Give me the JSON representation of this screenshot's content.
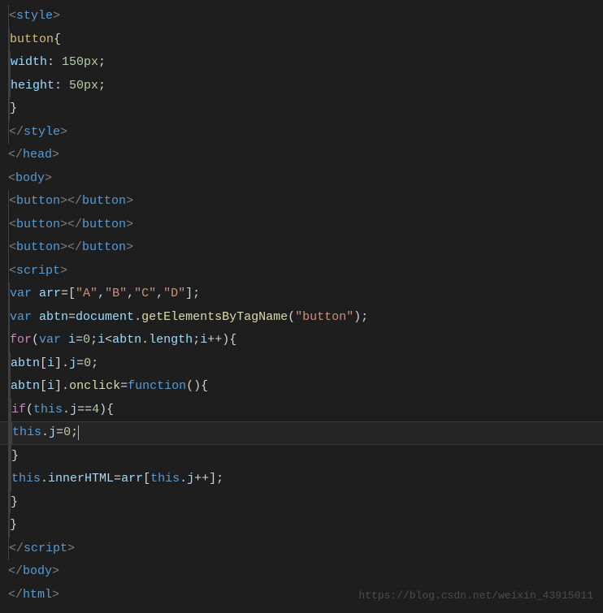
{
  "code": {
    "lines": [
      {
        "indent": 1,
        "tokens": [
          {
            "t": "<",
            "c": "tag-bracket"
          },
          {
            "t": "style",
            "c": "tag-name"
          },
          {
            "t": ">",
            "c": "tag-bracket"
          }
        ]
      },
      {
        "indent": 2,
        "tokens": [
          {
            "t": "button",
            "c": "selector"
          },
          {
            "t": "{",
            "c": "brace"
          }
        ]
      },
      {
        "indent": 3,
        "tokens": [
          {
            "t": "width",
            "c": "property"
          },
          {
            "t": ": ",
            "c": "punct"
          },
          {
            "t": "150px",
            "c": "value-num"
          },
          {
            "t": ";",
            "c": "punct"
          }
        ]
      },
      {
        "indent": 3,
        "tokens": [
          {
            "t": "height",
            "c": "property"
          },
          {
            "t": ": ",
            "c": "punct"
          },
          {
            "t": "50px",
            "c": "value-num"
          },
          {
            "t": ";",
            "c": "punct"
          }
        ]
      },
      {
        "indent": 2,
        "tokens": [
          {
            "t": "}",
            "c": "brace"
          }
        ]
      },
      {
        "indent": 1,
        "tokens": [
          {
            "t": "</",
            "c": "tag-bracket"
          },
          {
            "t": "style",
            "c": "tag-name"
          },
          {
            "t": ">",
            "c": "tag-bracket"
          }
        ]
      },
      {
        "indent": 0,
        "tokens": [
          {
            "t": "</",
            "c": "tag-bracket"
          },
          {
            "t": "head",
            "c": "tag-name"
          },
          {
            "t": ">",
            "c": "tag-bracket"
          }
        ]
      },
      {
        "indent": 0,
        "tokens": [
          {
            "t": "<",
            "c": "tag-bracket"
          },
          {
            "t": "body",
            "c": "tag-name"
          },
          {
            "t": ">",
            "c": "tag-bracket"
          }
        ]
      },
      {
        "indent": 1,
        "tokens": [
          {
            "t": "<",
            "c": "tag-bracket"
          },
          {
            "t": "button",
            "c": "tag-name"
          },
          {
            "t": "></",
            "c": "tag-bracket"
          },
          {
            "t": "button",
            "c": "tag-name"
          },
          {
            "t": ">",
            "c": "tag-bracket"
          }
        ]
      },
      {
        "indent": 1,
        "tokens": [
          {
            "t": "<",
            "c": "tag-bracket"
          },
          {
            "t": "button",
            "c": "tag-name"
          },
          {
            "t": "></",
            "c": "tag-bracket"
          },
          {
            "t": "button",
            "c": "tag-name"
          },
          {
            "t": ">",
            "c": "tag-bracket"
          }
        ]
      },
      {
        "indent": 1,
        "tokens": [
          {
            "t": "<",
            "c": "tag-bracket"
          },
          {
            "t": "button",
            "c": "tag-name"
          },
          {
            "t": "></",
            "c": "tag-bracket"
          },
          {
            "t": "button",
            "c": "tag-name"
          },
          {
            "t": ">",
            "c": "tag-bracket"
          }
        ]
      },
      {
        "indent": 1,
        "tokens": [
          {
            "t": "<",
            "c": "tag-bracket"
          },
          {
            "t": "script",
            "c": "tag-name"
          },
          {
            "t": ">",
            "c": "tag-bracket"
          }
        ]
      },
      {
        "indent": 2,
        "tokens": [
          {
            "t": "var ",
            "c": "keyword"
          },
          {
            "t": "arr",
            "c": "variable"
          },
          {
            "t": "=[",
            "c": "punct"
          },
          {
            "t": "\"A\"",
            "c": "string"
          },
          {
            "t": ",",
            "c": "punct"
          },
          {
            "t": "\"B\"",
            "c": "string"
          },
          {
            "t": ",",
            "c": "punct"
          },
          {
            "t": "\"C\"",
            "c": "string"
          },
          {
            "t": ",",
            "c": "punct"
          },
          {
            "t": "\"D\"",
            "c": "string"
          },
          {
            "t": "];",
            "c": "punct"
          }
        ]
      },
      {
        "indent": 2,
        "tokens": [
          {
            "t": "var ",
            "c": "keyword"
          },
          {
            "t": "abtn",
            "c": "variable"
          },
          {
            "t": "=",
            "c": "punct"
          },
          {
            "t": "document",
            "c": "obj"
          },
          {
            "t": ".",
            "c": "punct"
          },
          {
            "t": "getElementsByTagName",
            "c": "method"
          },
          {
            "t": "(",
            "c": "punct"
          },
          {
            "t": "\"button\"",
            "c": "string"
          },
          {
            "t": ");",
            "c": "punct"
          }
        ]
      },
      {
        "indent": 2,
        "tokens": [
          {
            "t": "for",
            "c": "keyword-control"
          },
          {
            "t": "(",
            "c": "punct"
          },
          {
            "t": "var ",
            "c": "keyword"
          },
          {
            "t": "i",
            "c": "variable"
          },
          {
            "t": "=",
            "c": "punct"
          },
          {
            "t": "0",
            "c": "number"
          },
          {
            "t": ";",
            "c": "punct"
          },
          {
            "t": "i",
            "c": "variable"
          },
          {
            "t": "<",
            "c": "punct"
          },
          {
            "t": "abtn",
            "c": "variable"
          },
          {
            "t": ".",
            "c": "punct"
          },
          {
            "t": "length",
            "c": "variable"
          },
          {
            "t": ";",
            "c": "punct"
          },
          {
            "t": "i",
            "c": "variable"
          },
          {
            "t": "++){",
            "c": "punct"
          }
        ]
      },
      {
        "indent": 3,
        "tokens": [
          {
            "t": "abtn",
            "c": "variable"
          },
          {
            "t": "[",
            "c": "punct"
          },
          {
            "t": "i",
            "c": "variable"
          },
          {
            "t": "].",
            "c": "punct"
          },
          {
            "t": "j",
            "c": "variable"
          },
          {
            "t": "=",
            "c": "punct"
          },
          {
            "t": "0",
            "c": "number"
          },
          {
            "t": ";",
            "c": "punct"
          }
        ]
      },
      {
        "indent": 3,
        "tokens": [
          {
            "t": "abtn",
            "c": "variable"
          },
          {
            "t": "[",
            "c": "punct"
          },
          {
            "t": "i",
            "c": "variable"
          },
          {
            "t": "].",
            "c": "punct"
          },
          {
            "t": "onclick",
            "c": "method"
          },
          {
            "t": "=",
            "c": "punct"
          },
          {
            "t": "function",
            "c": "keyword"
          },
          {
            "t": "(){",
            "c": "punct"
          }
        ]
      },
      {
        "indent": 4,
        "tokens": [
          {
            "t": "if",
            "c": "keyword-control"
          },
          {
            "t": "(",
            "c": "punct"
          },
          {
            "t": "this",
            "c": "const-this"
          },
          {
            "t": ".",
            "c": "punct"
          },
          {
            "t": "j",
            "c": "variable"
          },
          {
            "t": "==",
            "c": "punct"
          },
          {
            "t": "4",
            "c": "number"
          },
          {
            "t": "){",
            "c": "punct"
          }
        ]
      },
      {
        "indent": 5,
        "highlight": true,
        "cursor": true,
        "tokens": [
          {
            "t": "this",
            "c": "const-this"
          },
          {
            "t": ".",
            "c": "punct"
          },
          {
            "t": "j",
            "c": "variable"
          },
          {
            "t": "=",
            "c": "punct"
          },
          {
            "t": "0",
            "c": "number"
          },
          {
            "t": ";",
            "c": "punct"
          }
        ]
      },
      {
        "indent": 4,
        "tokens": [
          {
            "t": "}",
            "c": "brace"
          }
        ]
      },
      {
        "indent": 4,
        "tokens": [
          {
            "t": "this",
            "c": "const-this"
          },
          {
            "t": ".",
            "c": "punct"
          },
          {
            "t": "innerHTML",
            "c": "variable"
          },
          {
            "t": "=",
            "c": "punct"
          },
          {
            "t": "arr",
            "c": "variable"
          },
          {
            "t": "[",
            "c": "punct"
          },
          {
            "t": "this",
            "c": "const-this"
          },
          {
            "t": ".",
            "c": "punct"
          },
          {
            "t": "j",
            "c": "variable"
          },
          {
            "t": "++];",
            "c": "punct"
          }
        ]
      },
      {
        "indent": 3,
        "tokens": [
          {
            "t": "}",
            "c": "brace"
          }
        ]
      },
      {
        "indent": 2,
        "tokens": [
          {
            "t": "}",
            "c": "brace"
          }
        ]
      },
      {
        "indent": 1,
        "tokens": [
          {
            "t": "</",
            "c": "tag-bracket"
          },
          {
            "t": "script",
            "c": "tag-name"
          },
          {
            "t": ">",
            "c": "tag-bracket"
          }
        ]
      },
      {
        "indent": 0,
        "tokens": [
          {
            "t": "</",
            "c": "tag-bracket"
          },
          {
            "t": "body",
            "c": "tag-name"
          },
          {
            "t": ">",
            "c": "tag-bracket"
          }
        ]
      },
      {
        "indent": 0,
        "tokens": [
          {
            "t": "</",
            "c": "tag-bracket"
          },
          {
            "t": "html",
            "c": "tag-name"
          },
          {
            "t": ">",
            "c": "tag-bracket"
          }
        ]
      }
    ]
  },
  "watermark": "https://blog.csdn.net/weixin_43915011",
  "indent_unit": "    "
}
